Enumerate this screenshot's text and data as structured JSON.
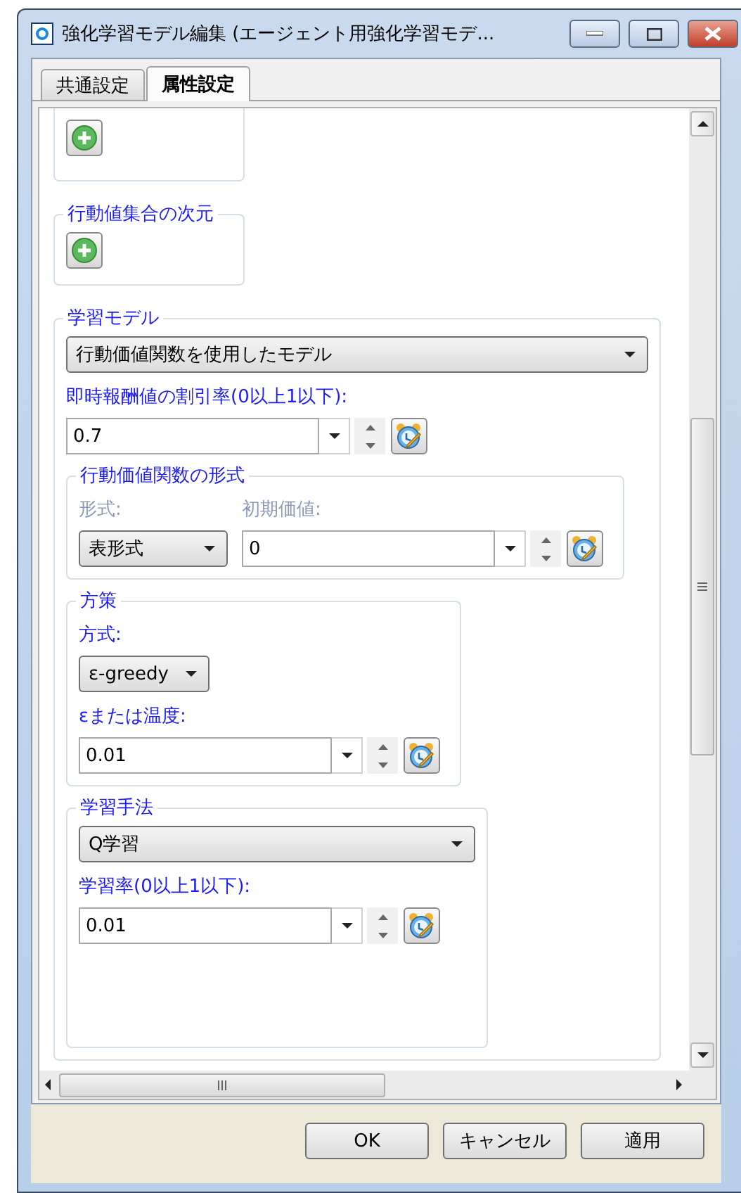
{
  "window": {
    "title": "強化学習モデル編集 (エージェント用強化学習モデ..."
  },
  "tabs": [
    {
      "label": "共通設定",
      "selected": false
    },
    {
      "label": "属性設定",
      "selected": true
    }
  ],
  "add_groups": [
    {
      "kind": "clipped"
    },
    {
      "kind": "titled",
      "title": "行動値集合の次元"
    }
  ],
  "learning_model": {
    "title": "学習モデル",
    "model_select": "行動価値関数を使用したモデル",
    "discount": {
      "label": "即時報酬値の割引率(0以上1以下):",
      "value": "0.7"
    },
    "value_function": {
      "title": "行動価値関数の形式",
      "format_label": {
        "text": "形式:",
        "disabled": true
      },
      "initial_label": {
        "text": "初期価値:",
        "disabled": true
      },
      "format_select": "表形式",
      "initial_value": "0"
    },
    "policy": {
      "title": "方策",
      "method_label": "方式:",
      "method_select": "ε-greedy",
      "param_label": "εまたは温度:",
      "param_value": "0.01"
    },
    "method": {
      "title": "学習手法",
      "select": "Q学習",
      "rate_label": "学習率(0以上1以下):",
      "rate_value": "0.01"
    }
  },
  "buttons": [
    "OK",
    "キャンセル",
    "適用"
  ]
}
